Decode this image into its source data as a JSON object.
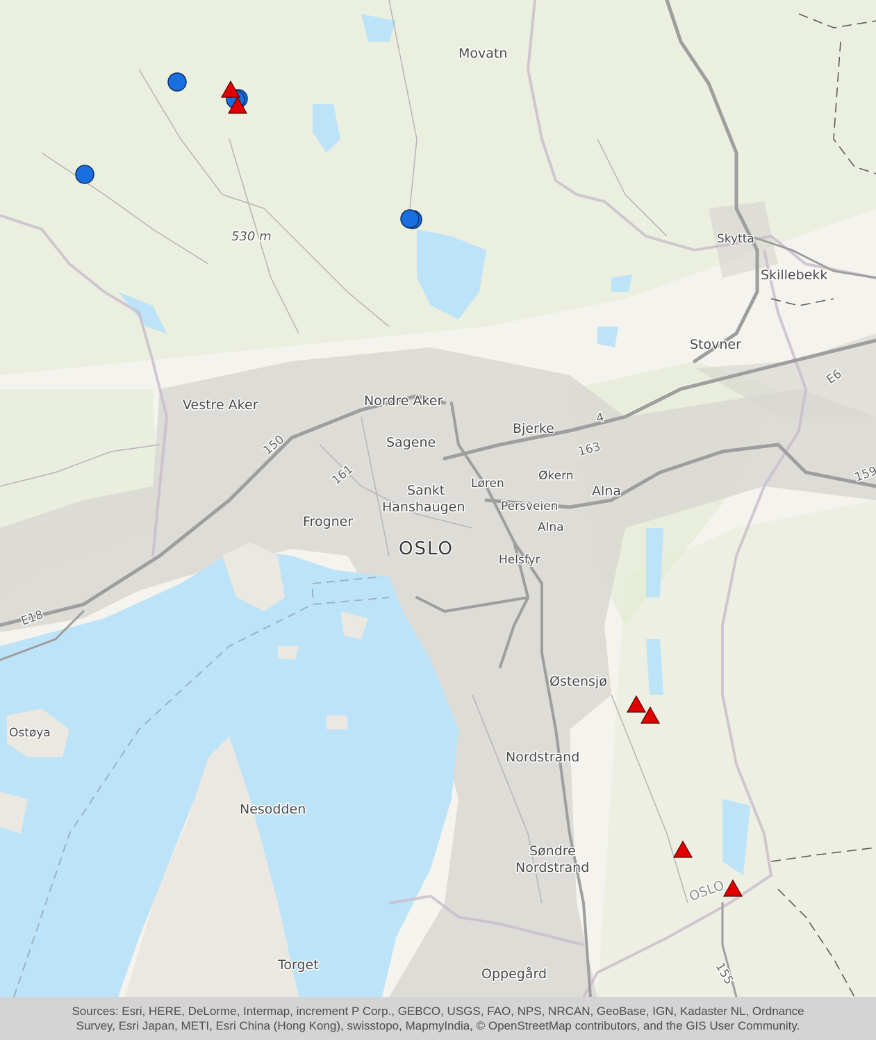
{
  "map": {
    "places": [
      {
        "id": "movatn",
        "label": "Movatn"
      },
      {
        "id": "elev",
        "label": "530 m"
      },
      {
        "id": "skytta",
        "label": "Skytta"
      },
      {
        "id": "skillebekk",
        "label": "Skillebekk"
      },
      {
        "id": "stovner",
        "label": "Stovner"
      },
      {
        "id": "vestre-aker",
        "label": "Vestre Aker"
      },
      {
        "id": "nordre-aker",
        "label": "Nordre Aker"
      },
      {
        "id": "bjerke",
        "label": "Bjerke"
      },
      {
        "id": "sagene",
        "label": "Sagene"
      },
      {
        "id": "okern",
        "label": "Økern"
      },
      {
        "id": "loren",
        "label": "Løren"
      },
      {
        "id": "sankt",
        "label": "Sankt"
      },
      {
        "id": "hanshaugen",
        "label": "Hanshaugen"
      },
      {
        "id": "alna",
        "label": "Alna"
      },
      {
        "id": "persveien",
        "label": "Persveien"
      },
      {
        "id": "alna2",
        "label": "Alna"
      },
      {
        "id": "frogner",
        "label": "Frogner"
      },
      {
        "id": "oslo",
        "label": "OSLO"
      },
      {
        "id": "helsfyr",
        "label": "Helsfyr"
      },
      {
        "id": "ostensjo",
        "label": "Østensjø"
      },
      {
        "id": "ostoya",
        "label": "Ostøya"
      },
      {
        "id": "nordstrand",
        "label": "Nordstrand"
      },
      {
        "id": "nesodden",
        "label": "Nesodden"
      },
      {
        "id": "sondre",
        "label": "Søndre"
      },
      {
        "id": "nordstrand2",
        "label": "Nordstrand"
      },
      {
        "id": "oslo2",
        "label": "OSLO"
      },
      {
        "id": "torget",
        "label": "Torget"
      },
      {
        "id": "oppegard",
        "label": "Oppegård"
      }
    ],
    "road_labels": [
      "150",
      "161",
      "163",
      "4",
      "E6",
      "159",
      "E18",
      "155"
    ],
    "colors": {
      "circle": "#1a6fe0",
      "triangle": "#e00000",
      "water": "#bde3f8",
      "land": "#f4f3ee",
      "green": "#dfe9cd",
      "urban": "#d9d7d2"
    }
  },
  "attribution": {
    "line1": "Sources: Esri, HERE, DeLorme, Intermap, increment P Corp., GEBCO, USGS, FAO, NPS, NRCAN, GeoBase, IGN, Kadaster NL, Ordnance",
    "line2": "Survey, Esri Japan, METI, Esri China (Hong Kong), swisstopo, MapmyIndia, © OpenStreetMap contributors, and the GIS User Community."
  }
}
